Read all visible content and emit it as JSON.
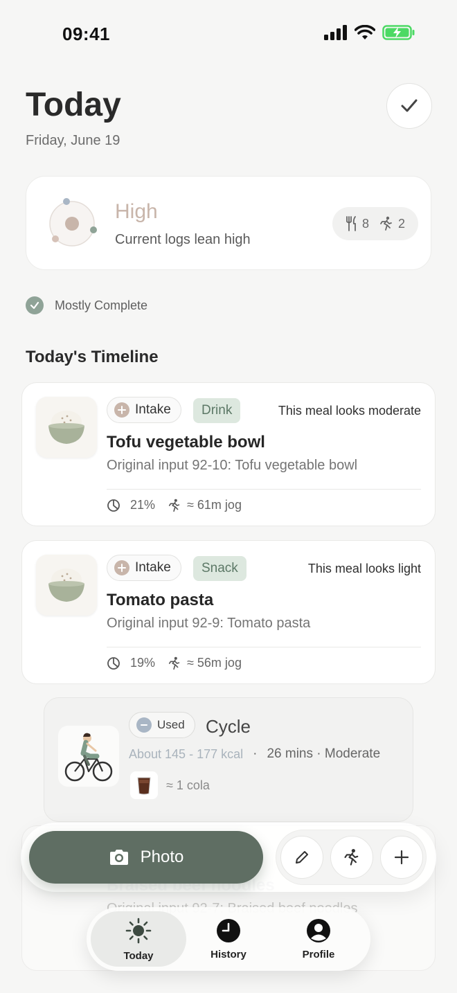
{
  "status_bar": {
    "time": "09:41"
  },
  "header": {
    "title": "Today",
    "date": "Friday, June 19"
  },
  "summary": {
    "level": "High",
    "subtitle": "Current logs lean high",
    "meal_count": "8",
    "exercise_count": "2"
  },
  "completeness": "Mostly Complete",
  "timeline": {
    "title": "Today's Timeline",
    "entries": [
      {
        "tag": "Intake",
        "type": "Drink",
        "verdict": "This meal looks moderate",
        "name": "Tofu vegetable bowl",
        "original": "Original input 92-10: Tofu vegetable bowl",
        "percent": "21%",
        "jog": "≈ 61m jog"
      },
      {
        "tag": "Intake",
        "type": "Snack",
        "verdict": "This meal looks light",
        "name": "Tomato pasta",
        "original": "Original input 92-9: Tomato pasta",
        "percent": "19%",
        "jog": "≈ 56m jog"
      }
    ],
    "activity": {
      "tag": "Used",
      "name": "Cycle",
      "kcal": "About 145 - 177 kcal",
      "sep": "·",
      "duration": "26 mins · Moderate",
      "equivalent": "≈ 1 cola"
    },
    "partial": {
      "name": "Braised beef noodles",
      "original": "Original input 92-7: Braised beef noodles"
    }
  },
  "actions": {
    "photo_label": "Photo",
    "tools": [
      "pencil-icon",
      "runner-icon",
      "plus-icon"
    ]
  },
  "tabs": [
    {
      "label": "Today",
      "icon": "sun-icon"
    },
    {
      "label": "History",
      "icon": "clock-icon"
    },
    {
      "label": "Profile",
      "icon": "profile-icon"
    }
  ],
  "colors": {
    "accent": "#5f6e63",
    "level": "#c8b5aa",
    "tag_green": "#dde8df",
    "battery": "#4cd964"
  }
}
